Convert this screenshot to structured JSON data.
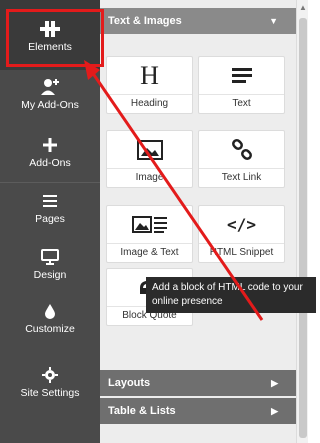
{
  "sidebar": {
    "items": [
      {
        "label": "Elements",
        "icon": "elements-icon"
      },
      {
        "label": "My Add-Ons",
        "icon": "addons-person-icon"
      },
      {
        "label": "Add-Ons",
        "icon": "plus-icon"
      },
      {
        "label": "Pages",
        "icon": "pages-icon"
      },
      {
        "label": "Design",
        "icon": "monitor-icon"
      },
      {
        "label": "Customize",
        "icon": "droplet-icon"
      },
      {
        "label": "Site Settings",
        "icon": "gear-icon"
      }
    ]
  },
  "panel": {
    "header": "Text & Images",
    "tiles": [
      {
        "label": "Heading",
        "glyph": "H"
      },
      {
        "label": "Text"
      },
      {
        "label": "Image"
      },
      {
        "label": "Text Link"
      },
      {
        "label": "Image & Text"
      },
      {
        "label": "HTML Snippet",
        "glyph": "</>"
      },
      {
        "label": "Block Quote"
      }
    ],
    "sections": [
      {
        "label": "Layouts"
      },
      {
        "label": "Table & Lists"
      }
    ]
  },
  "tooltip": {
    "text": "Add a block of HTML code to your online presence"
  },
  "colors": {
    "sidebar": "#4a4a4a",
    "highlight": "#e31b1b",
    "header": "#8a8a8a",
    "panel": "#ededed"
  }
}
